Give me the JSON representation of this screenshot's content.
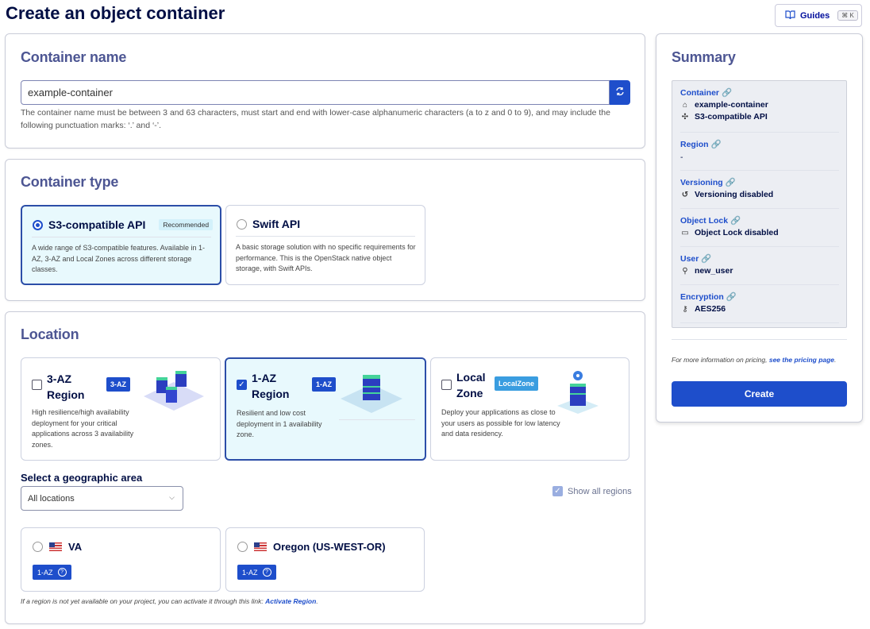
{
  "page_title": "Create an object container",
  "guides": {
    "label": "Guides",
    "shortcut": "⌘ K"
  },
  "container_name": {
    "heading": "Container name",
    "value": "example-container",
    "help": "The container name must be between 3 and 63 characters, must start and end with lower-case alphanumeric characters (a to z and 0 to 9), and may include the following punctuation marks: ‘.’ and ‘-’."
  },
  "container_type": {
    "heading": "Container type",
    "options": [
      {
        "title": "S3-compatible API",
        "badge": "Recommended",
        "desc": "A wide range of S3-compatible features. Available in 1-AZ, 3-AZ and Local Zones across different storage classes.",
        "selected": true
      },
      {
        "title": "Swift API",
        "desc": "A basic storage solution with no specific requirements for performance. This is the OpenStack native object storage, with Swift APIs.",
        "selected": false
      }
    ]
  },
  "location": {
    "heading": "Location",
    "options": [
      {
        "title": "3-AZ Region",
        "badge": "3-AZ",
        "desc": "High resilience/high availability deployment for your critical applications across 3 availability zones.",
        "checked": false
      },
      {
        "title": "1-AZ Region",
        "badge": "1-AZ",
        "desc": "Resilient and low cost deployment in 1 availability zone.",
        "checked": true
      },
      {
        "title": "Local Zone",
        "badge": "LocalZone",
        "desc": "Deploy your applications as close to your users as possible for low latency and data residency.",
        "checked": false
      }
    ],
    "geo_label": "Select a geographic area",
    "geo_value": "All locations",
    "show_all": "Show all regions",
    "regions": [
      {
        "name": "VA",
        "badge": "1-AZ"
      },
      {
        "name": "Oregon (US-WEST-OR)",
        "badge": "1-AZ"
      }
    ],
    "note": "If a region is not yet available on your project, you can activate it through this link:",
    "note_link": "Activate Region"
  },
  "summary": {
    "heading": "Summary",
    "container_label": "Container",
    "container_name": "example-container",
    "container_api": "S3-compatible API",
    "region_label": "Region",
    "region_value": "-",
    "versioning_label": "Versioning",
    "versioning_value": "Versioning disabled",
    "lock_label": "Object Lock",
    "lock_value": "Object Lock disabled",
    "user_label": "User",
    "user_value": "new_user",
    "enc_label": "Encryption",
    "enc_value": "AES256",
    "pricing": "For more information on pricing,",
    "pricing_link": "see the pricing page",
    "create": "Create"
  },
  "colors": {
    "primary": "#1e4ecb",
    "selected_bg": "#e8f9fd",
    "heading": "#4d5693"
  }
}
